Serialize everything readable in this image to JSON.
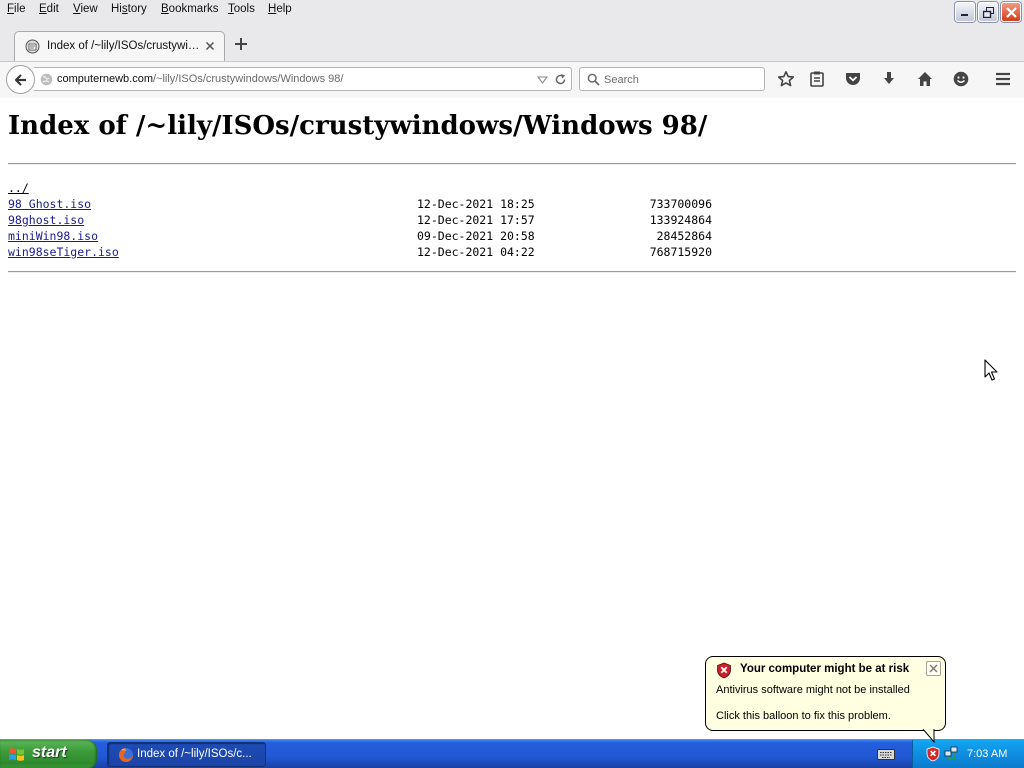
{
  "window": {
    "menu": [
      "File",
      "Edit",
      "View",
      "History",
      "Bookmarks",
      "Tools",
      "Help"
    ],
    "menu_access_keys": [
      "F",
      "E",
      "V",
      "s",
      "B",
      "T",
      "H"
    ]
  },
  "tab": {
    "title": "Index of /~lily/ISOs/crustywi…",
    "new_tab_icon": "plus-icon",
    "close_icon": "close-icon"
  },
  "navbar": {
    "url_host": "computernewb.com",
    "url_path": "/~lily/ISOs/crustywindows/Windows 98/",
    "search_placeholder": "Search",
    "toolbar_icons": [
      "star-icon",
      "reading-list-icon",
      "pocket-icon",
      "download-icon",
      "home-icon",
      "chat-icon",
      "hamburger-menu-icon"
    ]
  },
  "page": {
    "title": "Index of /~lily/ISOs/crustywindows/Windows 98/",
    "parent_link": "../",
    "files": [
      {
        "name": "98 Ghost.iso",
        "date": "12-Dec-2021 18:25",
        "size": "733700096"
      },
      {
        "name": "98ghost.iso",
        "date": "12-Dec-2021 17:57",
        "size": "133924864"
      },
      {
        "name": "miniWin98.iso",
        "date": "09-Dec-2021 20:58",
        "size": "28452864"
      },
      {
        "name": "win98seTiger.iso",
        "date": "12-Dec-2021 04:22",
        "size": "768715920"
      }
    ]
  },
  "balloon": {
    "title": "Your computer might be at risk",
    "line1": "Antivirus software might not be installed",
    "line2": "Click this balloon to fix this problem."
  },
  "taskbar": {
    "start_label": "start",
    "task_label": "Index of /~lily/ISOs/c...",
    "clock": "7:03 AM"
  },
  "colors": {
    "link": "#1a1a8c",
    "taskbar_blue": "#245edb",
    "start_green": "#3c9a3a",
    "balloon_bg": "#ffffe1"
  }
}
